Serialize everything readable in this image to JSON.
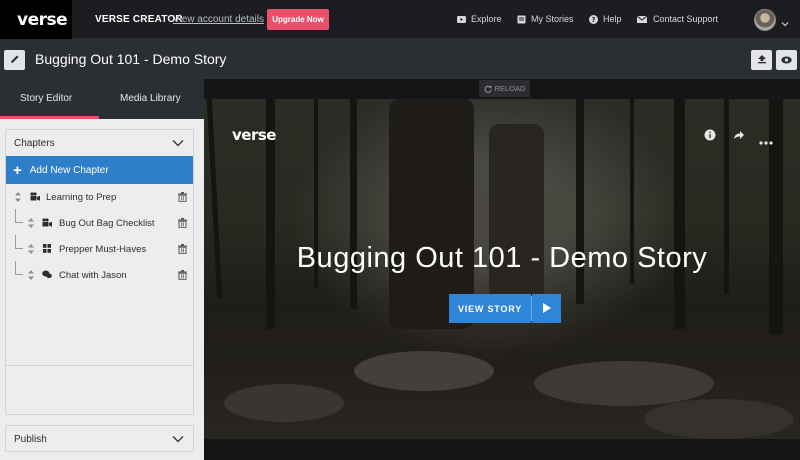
{
  "header": {
    "logo": "verse",
    "brand": "VERSE CREATOR",
    "account_link": "View account details",
    "upgrade_button": "Upgrade Now",
    "nav": [
      {
        "label": "Explore",
        "icon": "play-icon"
      },
      {
        "label": "My Stories",
        "icon": "stories-icon"
      },
      {
        "label": "Help",
        "icon": "help-icon"
      },
      {
        "label": "Contact Support",
        "icon": "mail-icon"
      }
    ]
  },
  "titlebar": {
    "title": "Bugging Out 101 - Demo Story"
  },
  "sidebar": {
    "tabs": [
      {
        "label": "Story Editor",
        "active": true
      },
      {
        "label": "Media Library",
        "active": false
      }
    ],
    "chapters_panel": {
      "title": "Chapters",
      "add_label": "Add New Chapter",
      "items": [
        {
          "label": "Learning to Prep",
          "icon": "video-icon",
          "level": 0
        },
        {
          "label": "Bug Out Bag Checklist",
          "icon": "video-icon",
          "level": 1
        },
        {
          "label": "Prepper Must-Haves",
          "icon": "grid-icon",
          "level": 1
        },
        {
          "label": "Chat with Jason",
          "icon": "chat-icon",
          "level": 1
        }
      ]
    },
    "publish_panel": {
      "title": "Publish"
    }
  },
  "preview": {
    "reload_label": "RELOAD",
    "logo": "verse",
    "title": "Bugging Out 101 - Demo Story",
    "view_button": "VIEW STORY"
  },
  "colors": {
    "accent": "#e8506b",
    "primary": "#2f7ec9",
    "view_button": "#2f86d8"
  }
}
